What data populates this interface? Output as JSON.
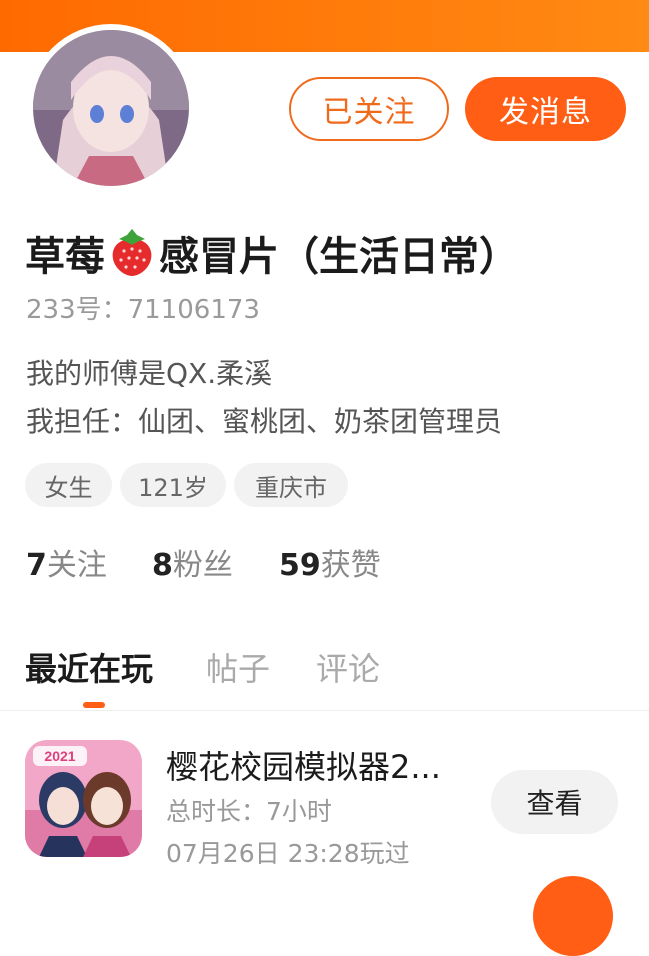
{
  "profile": {
    "name_before": "草莓",
    "name_after": "感冒片（生活日常）",
    "uid": "233号：71106173",
    "bio_line1": "我的师傅是QX.柔溪",
    "bio_line2": "我担任：仙团、蜜桃团、奶茶团管理员",
    "tags": [
      "女生",
      "121岁",
      "重庆市"
    ],
    "stats": {
      "following_count": "7",
      "following_label": "关注",
      "fans_count": "8",
      "fans_label": "粉丝",
      "likes_count": "59",
      "likes_label": "获赞"
    }
  },
  "actions": {
    "follow_label": "已关注",
    "message_label": "发消息"
  },
  "tabs": [
    {
      "label": "最近在玩",
      "active": true
    },
    {
      "label": "帖子",
      "active": false
    },
    {
      "label": "评论",
      "active": false
    }
  ],
  "recent_games": [
    {
      "title": "樱花校园模拟器2...",
      "icon_badge": "2021",
      "playtime": "总时长：7小时",
      "last_played": "07月26日 23:28玩过",
      "view_label": "查看"
    }
  ],
  "colors": {
    "accent": "#ff5e14",
    "header_gradient_start": "#ff6a00",
    "header_gradient_end": "#ff8a14"
  },
  "icons": {
    "avatar": "anime-avatar",
    "strawberry": "strawberry-emoji",
    "game_icon": "sakura-school-simulator-icon"
  }
}
